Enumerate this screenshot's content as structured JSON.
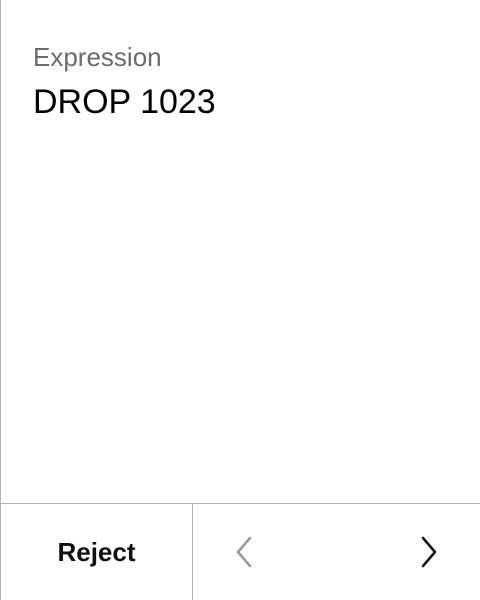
{
  "expression": {
    "label": "Expression",
    "value": "DROP 1023"
  },
  "footer": {
    "reject_label": "Reject",
    "prev_icon": "chevron-left-icon",
    "next_icon": "chevron-right-icon",
    "prev_enabled": false,
    "next_enabled": true
  },
  "colors": {
    "label": "#6b6b6b",
    "text": "#000000",
    "divider": "#b3b3b3",
    "disabled_icon": "#9a9a9a"
  }
}
